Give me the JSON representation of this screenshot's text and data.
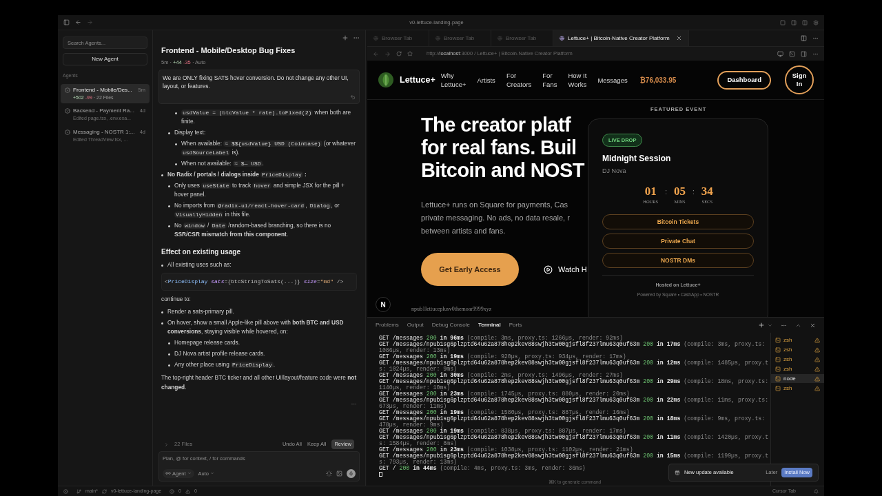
{
  "window": {
    "title": "v0-lettuce-landing-page"
  },
  "sidebar": {
    "search": {
      "placeholder": "Search Agents..."
    },
    "new_agent": "New Agent",
    "section": "Agents",
    "agents": [
      {
        "kind": "stats",
        "title": "Frontend - Mobile/Des...",
        "time": "5m",
        "added": "+502",
        "removed": "-99",
        "files": "· 22 Files",
        "selected": true
      },
      {
        "kind": "edited",
        "title": "Backend - Payment Ra...",
        "time": "4d",
        "detail": "Edited page.tsx, .env.exa...",
        "selected": false
      },
      {
        "kind": "edited",
        "title": "Messaging - NOSTR 1:...",
        "time": "4d",
        "detail": "Edited ThreadView.tsx, ...",
        "selected": false
      }
    ]
  },
  "chat": {
    "title": "Frontend - Mobile/Desktop Bug Fixes",
    "meta": {
      "separator": "·",
      "age": "5m",
      "added": "+44",
      "removed": "-35",
      "mode": "Auto"
    },
    "prompt": "We are ONLY fixing SATS hover conversion. Do not change any other UI, layout, or features.",
    "blocks": [
      {
        "kind": "list",
        "items": [
          {
            "children": [
              {
                "children": [
                  {
                    "segments": [
                      {
                        "kind": "code",
                        "text": "usdValue = (btcValue * rate).toFixed(2)"
                      },
                      {
                        "kind": "text",
                        "text": " when both are finite."
                      }
                    ]
                  }
                ]
              },
              {
                "segments": [
                  {
                    "kind": "text",
                    "text": "Display text:"
                  }
                ],
                "children": [
                  {
                    "segments": [
                      {
                        "kind": "text",
                        "text": "When available: "
                      },
                      {
                        "kind": "code",
                        "text": "≈ $${usdValue} USD (Coinbase)"
                      },
                      {
                        "kind": "text",
                        "text": " (or whatever "
                      },
                      {
                        "kind": "code",
                        "text": "usdSourceLabel"
                      },
                      {
                        "kind": "text",
                        "text": " is)."
                      }
                    ]
                  },
                  {
                    "segments": [
                      {
                        "kind": "text",
                        "text": "When not available: "
                      },
                      {
                        "kind": "code",
                        "text": "≈ $— USD"
                      },
                      {
                        "kind": "text",
                        "text": "."
                      }
                    ]
                  }
                ]
              }
            ]
          },
          {
            "segments": [
              {
                "kind": "text",
                "text": "**No Radix / portals / dialogs inside** "
              },
              {
                "kind": "code",
                "text": "PriceDisplay"
              },
              {
                "kind": "text",
                "text": " **:**"
              }
            ],
            "children": [
              {
                "segments": [
                  {
                    "kind": "text",
                    "text": "Only uses "
                  },
                  {
                    "kind": "code",
                    "text": "useState"
                  },
                  {
                    "kind": "text",
                    "text": " to track "
                  },
                  {
                    "kind": "code",
                    "text": "hover"
                  },
                  {
                    "kind": "text",
                    "text": " and simple JSX for the pill + hover panel."
                  }
                ]
              },
              {
                "segments": [
                  {
                    "kind": "text",
                    "text": "No imports from "
                  },
                  {
                    "kind": "code",
                    "text": "@radix-ui/react-hover-card"
                  },
                  {
                    "kind": "text",
                    "text": ", "
                  },
                  {
                    "kind": "code",
                    "text": "Dialog"
                  },
                  {
                    "kind": "text",
                    "text": ", or "
                  },
                  {
                    "kind": "code",
                    "text": "VisuallyHidden"
                  },
                  {
                    "kind": "text",
                    "text": " in this file."
                  }
                ]
              },
              {
                "segments": [
                  {
                    "kind": "text",
                    "text": "No "
                  },
                  {
                    "kind": "code",
                    "text": "window"
                  },
                  {
                    "kind": "text",
                    "text": " / "
                  },
                  {
                    "kind": "code",
                    "text": "Date"
                  },
                  {
                    "kind": "text",
                    "text": " /random-based branching, so there is no **SSR/CSR mismatch from this component**."
                  }
                ]
              }
            ]
          }
        ]
      },
      {
        "kind": "heading",
        "text": "Effect on existing usage"
      },
      {
        "kind": "list",
        "items": [
          {
            "segments": [
              {
                "kind": "text",
                "text": "All existing uses such as:"
              }
            ]
          }
        ]
      },
      {
        "kind": "code",
        "tokens": [
          {
            "kind": "punct",
            "text": "<"
          },
          {
            "kind": "tag",
            "text": "PriceDisplay"
          },
          {
            "kind": "attr",
            "text": " sats"
          },
          {
            "kind": "punct",
            "text": "={btcStringToSats(...)}"
          },
          {
            "kind": "attr",
            "text": " size"
          },
          {
            "kind": "punct",
            "text": "="
          },
          {
            "kind": "string",
            "text": "\"md\""
          },
          {
            "kind": "punct",
            "text": " />"
          }
        ]
      },
      {
        "kind": "paragraph",
        "segments": [
          {
            "kind": "text",
            "text": "continue to:"
          }
        ]
      },
      {
        "kind": "list",
        "items": [
          {
            "segments": [
              {
                "kind": "text",
                "text": "Render a sats-primary pill."
              }
            ]
          },
          {
            "segments": [
              {
                "kind": "text",
                "text": "On hover, show a small Apple-like pill above with **both BTC and USD conversions**, staying visible while hovered, on:"
              }
            ],
            "children": [
              {
                "segments": [
                  {
                    "kind": "text",
                    "text": "Homepage release cards."
                  }
                ]
              },
              {
                "segments": [
                  {
                    "kind": "text",
                    "text": "DJ Nova artist profile release cards."
                  }
                ]
              },
              {
                "segments": [
                  {
                    "kind": "text",
                    "text": "Any other place using "
                  },
                  {
                    "kind": "code",
                    "text": "PriceDisplay"
                  },
                  {
                    "kind": "text",
                    "text": "."
                  }
                ]
              }
            ]
          }
        ]
      },
      {
        "kind": "paragraph",
        "segments": [
          {
            "kind": "text",
            "text": "The top-right header BTC ticker and all other UI/layout/feature code were **not changed**."
          }
        ]
      }
    ],
    "files_bar": {
      "files": "22 Files",
      "actions": [
        "Undo All",
        "Keep All"
      ],
      "review": "Review"
    },
    "input": {
      "placeholder": "Plan, @ for context, / for commands",
      "agent": "Agent",
      "model": "Auto"
    }
  },
  "browser": {
    "tabs": [
      {
        "label": "Browser Tab",
        "selected": false
      },
      {
        "label": "Browser Tab",
        "selected": false
      },
      {
        "label": "Browser Tab",
        "selected": false
      },
      {
        "label": "Lettuce+ | Bitcoin-Native Creator Platform",
        "selected": true
      }
    ],
    "url": {
      "scheme": "http://",
      "host": "localhost",
      "rest": ":3000 / Lettuce+ | Bitcoin-Native Creator Platform"
    },
    "page": {
      "logo": "Lettuce+",
      "nav": [
        {
          "lines": [
            "Why",
            "Lettuce+"
          ]
        },
        {
          "lines": [
            "Artists"
          ]
        },
        {
          "lines": [
            "For",
            "Creators"
          ]
        },
        {
          "lines": [
            "For",
            "Fans"
          ]
        },
        {
          "lines": [
            "How It",
            "Works"
          ]
        },
        {
          "lines": [
            "Messages"
          ]
        }
      ],
      "price": "₿76,033.95",
      "dashboard": "Dashboard",
      "sign_in": [
        "Sign",
        "In"
      ],
      "headline": [
        "The creator platf",
        "for real fans. Buil",
        "Bitcoin and NOST"
      ],
      "lede": [
        "Lettuce+ runs on Square for payments, Cas",
        "private messaging. No ads, no data resale, r",
        "between artists and fans."
      ],
      "cta": "Get Early Access",
      "watch": "Watch H",
      "dev_badge": "N",
      "npub": "npub1lettuceplusv0themoar9999xyz",
      "featured": {
        "label": "FEATURED EVENT",
        "badge": "LIVE DROP",
        "title": "Midnight Session",
        "artist": "DJ Nova",
        "separator": ":",
        "countdown": [
          {
            "value": "01",
            "unit": "HOURS"
          },
          {
            "value": "05",
            "unit": "MINS"
          },
          {
            "value": "34",
            "unit": "SECS"
          }
        ],
        "actions": [
          "Bitcoin Tickets",
          "Private Chat",
          "NOSTR DMs"
        ],
        "host": "Hosted on Lettuce+",
        "powered": "Powered by Square • CashApp • NOSTR"
      }
    }
  },
  "terminal": {
    "tabs": [
      {
        "label": "Problems",
        "selected": false
      },
      {
        "label": "Output",
        "selected": false
      },
      {
        "label": "Debug Console",
        "selected": false
      },
      {
        "label": "Terminal",
        "selected": true
      },
      {
        "label": "Ports",
        "selected": false
      }
    ],
    "logs": [
      {
        "method": "GET",
        "path": "/messages",
        "status": "200",
        "time": "in 96ms",
        "detail": "(compile: 3ms, proxy.ts: 1266µs, render: 92ms)"
      },
      {
        "method": "GET",
        "path": "/messages/npub1sg6plzptd64u62a878hep2kev88swjh3tw00gjsfl8f237lmu63q0uf63m",
        "status": "200",
        "time": "in 17ms",
        "detail": "(compile: 3ms, proxy.ts: 1086µs, render: 13ms)"
      },
      {
        "method": "GET",
        "path": "/messages",
        "status": "200",
        "time": "in 19ms",
        "detail": "(compile: 920µs, proxy.ts: 934µs, render: 17ms)"
      },
      {
        "method": "GET",
        "path": "/messages/npub1sg6plzptd64u62a878hep2kev88swjh3tw00gjsfl8f237lmu63q0uf63m",
        "status": "200",
        "time": "in 12ms",
        "detail": "(compile: 1485µs, proxy.ts: 1024µs, render: 9ms)"
      },
      {
        "method": "GET",
        "path": "/messages",
        "status": "200",
        "time": "in 30ms",
        "detail": "(compile: 2ms, proxy.ts: 1496µs, render: 27ms)"
      },
      {
        "method": "GET",
        "path": "/messages/npub1sg6plzptd64u62a878hep2kev88swjh3tw00gjsfl8f237lmu63q0uf63m",
        "status": "200",
        "time": "in 29ms",
        "detail": "(compile: 18ms, proxy.ts: 1140µs, render: 10ms)"
      },
      {
        "method": "GET",
        "path": "/messages",
        "status": "200",
        "time": "in 23ms",
        "detail": "(compile: 1745µs, proxy.ts: 880µs, render: 20ms)"
      },
      {
        "method": "GET",
        "path": "/messages/npub1sg6plzptd64u62a878hep2kev88swjh3tw00gjsfl8f237lmu63q0uf63m",
        "status": "200",
        "time": "in 22ms",
        "detail": "(compile: 11ms, proxy.ts: 673µs, render: 11ms)"
      },
      {
        "method": "GET",
        "path": "/messages",
        "status": "200",
        "time": "in 19ms",
        "detail": "(compile: 1580µs, proxy.ts: 887µs, render: 16ms)"
      },
      {
        "method": "GET",
        "path": "/messages/npub1sg6plzptd64u62a878hep2kev88swjh3tw00gjsfl8f237lmu63q0uf63m",
        "status": "200",
        "time": "in 18ms",
        "detail": "(compile: 9ms, proxy.ts: 478µs, render: 9ms)"
      },
      {
        "method": "GET",
        "path": "/messages",
        "status": "200",
        "time": "in 19ms",
        "detail": "(compile: 838µs, proxy.ts: 887µs, render: 17ms)"
      },
      {
        "method": "GET",
        "path": "/messages/npub1sg6plzptd64u62a878hep2kev88swjh3tw00gjsfl8f237lmu63q0uf63m",
        "status": "200",
        "time": "in 11ms",
        "detail": "(compile: 1420µs, proxy.ts: 1584µs, render: 8ms)"
      },
      {
        "method": "GET",
        "path": "/messages",
        "status": "200",
        "time": "in 23ms",
        "detail": "(compile: 1038µs, proxy.ts: 1102µs, render: 21ms)"
      },
      {
        "method": "GET",
        "path": "/messages/npub1sg6plzptd64u62a878hep2kev88swjh3tw00gjsfl8f237lmu63q0uf63m",
        "status": "200",
        "time": "in 15ms",
        "detail": "(compile: 1199µs, proxy.ts: 793µs, render: 13ms)"
      },
      {
        "method": "GET",
        "path": "/",
        "status": "200",
        "time": "in 44ms",
        "detail": "(compile: 4ms, proxy.ts: 3ms, render: 36ms)"
      }
    ],
    "hint": "⌘K to generate command",
    "sessions": [
      {
        "label": "zsh",
        "selected": false
      },
      {
        "label": "zsh",
        "selected": false
      },
      {
        "label": "zsh",
        "selected": false
      },
      {
        "label": "zsh",
        "selected": false
      },
      {
        "label": "node",
        "selected": true
      },
      {
        "label": "zsh",
        "selected": false
      }
    ]
  },
  "toast": {
    "message": "New update available",
    "later": "Later",
    "install": "Install Now"
  },
  "status_bar": {
    "branch": "main*",
    "project": "v0-lettuce-landing-page",
    "errors": "0",
    "warnings": "0",
    "right": "Cursor Tab"
  }
}
